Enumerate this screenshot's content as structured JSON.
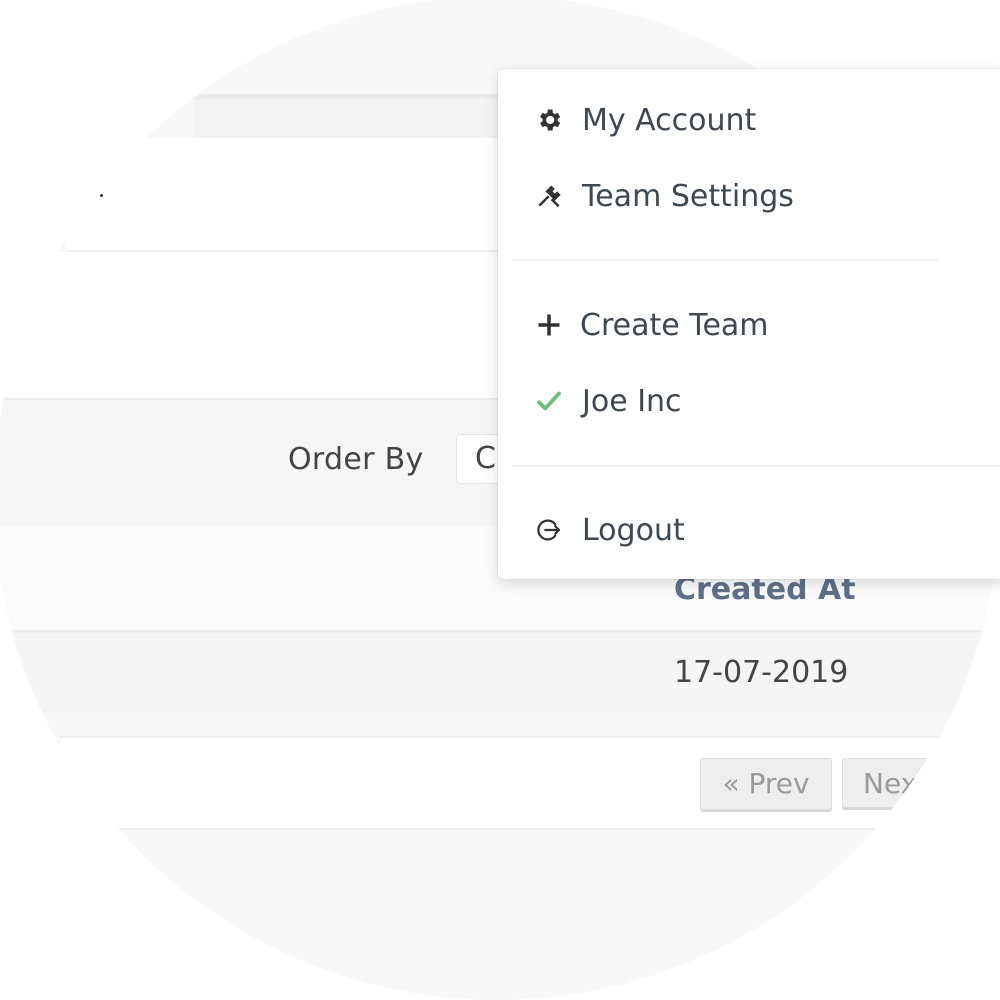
{
  "filter": {
    "order_by_label": "Order By",
    "order_by_value": "C"
  },
  "table": {
    "columns": [
      "Created At"
    ],
    "rows": [
      {
        "created_at": "17-07-2019"
      }
    ]
  },
  "pagination": {
    "prev_label": "« Prev",
    "next_label": "Next"
  },
  "dropdown": {
    "items": [
      {
        "label": "My Account",
        "icon": "gear-icon"
      },
      {
        "label": "Team Settings",
        "icon": "tools-icon"
      },
      {
        "label": "Create Team",
        "icon": "plus-icon"
      },
      {
        "label": "Joe Inc",
        "icon": "check-icon",
        "icon_color": "#6cc07f"
      },
      {
        "label": "Logout",
        "icon": "logout-icon"
      }
    ]
  },
  "colors": {
    "column_header": "#5f6f87",
    "text": "#3d4852",
    "check": "#6cc07f"
  }
}
